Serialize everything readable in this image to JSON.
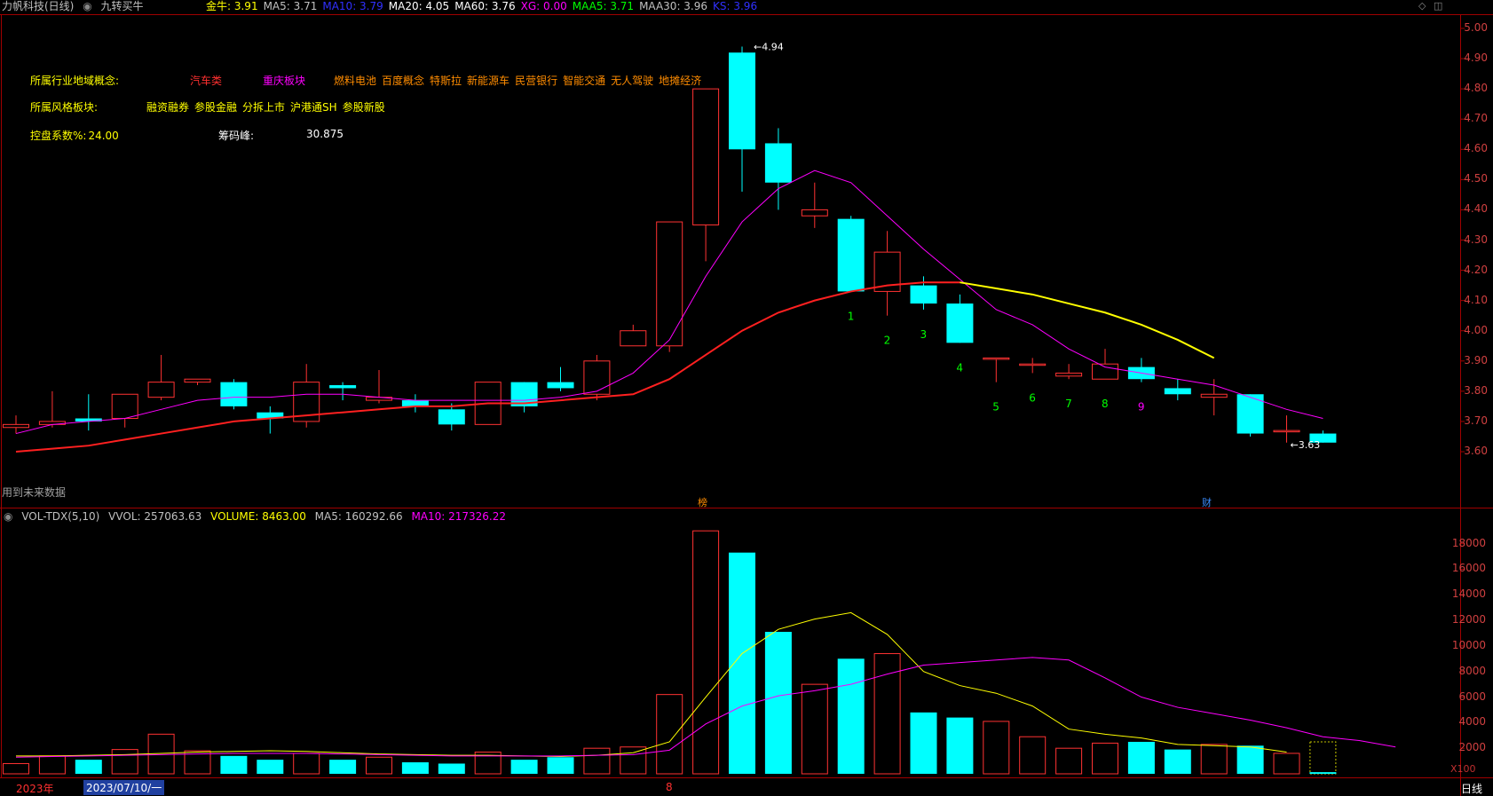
{
  "header": {
    "stock_title": "力帆科技(日线)",
    "strategy_label": "九转买牛",
    "indicators": [
      {
        "label": "金牛: 3.91",
        "color": "#ffff00"
      },
      {
        "label": "MA5: 3.71",
        "color": "#c0c0c0"
      },
      {
        "label": "MA10: 3.79",
        "color": "#3030ff"
      },
      {
        "label": "MA20: 4.05",
        "color": "#ffffff"
      },
      {
        "label": "MA60: 3.76",
        "color": "#ffffff"
      },
      {
        "label": "XG: 0.00",
        "color": "#ff00ff"
      },
      {
        "label": "MAA5: 3.71",
        "color": "#00ff00"
      },
      {
        "label": "MAA30: 3.96",
        "color": "#c0c0c0"
      },
      {
        "label": "KS: 3.96",
        "color": "#3030ff"
      }
    ]
  },
  "info": {
    "industry_label": "所属行业地域概念:",
    "industry_main": "汽车类",
    "region": "重庆板块",
    "concepts": [
      "燃料电池",
      "百度概念",
      "特斯拉",
      "新能源车",
      "民营银行",
      "智能交通",
      "无人驾驶",
      "地摊经济"
    ],
    "style_label": "所属风格板块:",
    "styles": [
      "融资融券",
      "参股金融",
      "分拆上市",
      "沪港通SH",
      "参股新股"
    ],
    "control_label": "控盘系数%:",
    "control_value": "24.00",
    "chip_label": "筹码峰:",
    "chip_value": "30.875"
  },
  "future_data_label": "用到未来数据",
  "markers": {
    "dragon": "榜",
    "finance": "财",
    "high": "4.94",
    "low": "3.63"
  },
  "volume_header": {
    "name": "VOL-TDX(5,10)",
    "vvol": "VVOL: 257063.63",
    "volume": "VOLUME: 8463.00",
    "ma5": "MA5: 160292.66",
    "ma10": "MA10: 217326.22"
  },
  "volume_unit": "X100",
  "bottom": {
    "year": "2023年",
    "date": "2023/07/10/一",
    "month": "8",
    "period": "日线"
  },
  "colors": {
    "up": "#ff3232",
    "down": "#00ffff",
    "ma_magenta": "#ff00ff",
    "ma_red": "#ff2020",
    "ma_yellow": "#ffff00",
    "axis": "#a00000"
  },
  "chart_data": {
    "type": "candlestick",
    "price_axis": {
      "ticks": [
        "5.00",
        "4.90",
        "4.80",
        "4.70",
        "4.60",
        "4.50",
        "4.40",
        "4.30",
        "4.20",
        "4.10",
        "4.00",
        "3.90",
        "3.80",
        "3.70",
        "3.60"
      ],
      "ylim": [
        3.545,
        5.0
      ]
    },
    "candles": [
      {
        "o": 3.68,
        "c": 3.69,
        "h": 3.72,
        "l": 3.66
      },
      {
        "o": 3.69,
        "c": 3.7,
        "h": 3.8,
        "l": 3.68
      },
      {
        "o": 3.71,
        "c": 3.7,
        "h": 3.79,
        "l": 3.67
      },
      {
        "o": 3.71,
        "c": 3.79,
        "h": 3.79,
        "l": 3.68
      },
      {
        "o": 3.78,
        "c": 3.83,
        "h": 3.92,
        "l": 3.77
      },
      {
        "o": 3.83,
        "c": 3.84,
        "h": 3.84,
        "l": 3.82
      },
      {
        "o": 3.83,
        "c": 3.75,
        "h": 3.84,
        "l": 3.74
      },
      {
        "o": 3.73,
        "c": 3.71,
        "h": 3.75,
        "l": 3.66
      },
      {
        "o": 3.7,
        "c": 3.83,
        "h": 3.89,
        "l": 3.68
      },
      {
        "o": 3.82,
        "c": 3.81,
        "h": 3.83,
        "l": 3.77
      },
      {
        "o": 3.77,
        "c": 3.78,
        "h": 3.87,
        "l": 3.76
      },
      {
        "o": 3.77,
        "c": 3.75,
        "h": 3.79,
        "l": 3.73
      },
      {
        "o": 3.74,
        "c": 3.69,
        "h": 3.76,
        "l": 3.67
      },
      {
        "o": 3.69,
        "c": 3.83,
        "h": 3.83,
        "l": 3.69
      },
      {
        "o": 3.83,
        "c": 3.75,
        "h": 3.83,
        "l": 3.73
      },
      {
        "o": 3.83,
        "c": 3.81,
        "h": 3.88,
        "l": 3.8
      },
      {
        "o": 3.79,
        "c": 3.9,
        "h": 3.92,
        "l": 3.77
      },
      {
        "o": 3.95,
        "c": 4.0,
        "h": 4.02,
        "l": 3.95
      },
      {
        "o": 3.95,
        "c": 4.36,
        "h": 4.36,
        "l": 3.93
      },
      {
        "o": 4.35,
        "c": 4.8,
        "h": 4.8,
        "l": 4.23
      },
      {
        "o": 4.92,
        "c": 4.6,
        "h": 4.94,
        "l": 4.46
      },
      {
        "o": 4.62,
        "c": 4.49,
        "h": 4.67,
        "l": 4.4
      },
      {
        "o": 4.38,
        "c": 4.4,
        "h": 4.49,
        "l": 4.34
      },
      {
        "o": 4.37,
        "c": 4.13,
        "h": 4.38,
        "l": 4.13
      },
      {
        "o": 4.13,
        "c": 4.26,
        "h": 4.33,
        "l": 4.05
      },
      {
        "o": 4.15,
        "c": 4.09,
        "h": 4.18,
        "l": 4.07
      },
      {
        "o": 4.09,
        "c": 3.96,
        "h": 4.12,
        "l": 3.96
      },
      {
        "o": 3.91,
        "c": 3.91,
        "h": 3.91,
        "l": 3.83
      },
      {
        "o": 3.89,
        "c": 3.89,
        "h": 3.91,
        "l": 3.86
      },
      {
        "o": 3.85,
        "c": 3.86,
        "h": 3.89,
        "l": 3.84
      },
      {
        "o": 3.84,
        "c": 3.89,
        "h": 3.94,
        "l": 3.84
      },
      {
        "o": 3.88,
        "c": 3.84,
        "h": 3.91,
        "l": 3.83
      },
      {
        "o": 3.81,
        "c": 3.79,
        "h": 3.84,
        "l": 3.77
      },
      {
        "o": 3.78,
        "c": 3.79,
        "h": 3.84,
        "l": 3.72
      },
      {
        "o": 3.79,
        "c": 3.66,
        "h": 3.79,
        "l": 3.65
      },
      {
        "o": 3.67,
        "c": 3.67,
        "h": 3.72,
        "l": 3.63
      },
      {
        "o": 3.66,
        "c": 3.63,
        "h": 3.67,
        "l": 3.63
      }
    ],
    "ma_short": [
      3.66,
      3.69,
      3.7,
      3.71,
      3.74,
      3.77,
      3.78,
      3.78,
      3.79,
      3.79,
      3.78,
      3.77,
      3.77,
      3.77,
      3.77,
      3.78,
      3.8,
      3.86,
      3.97,
      4.18,
      4.36,
      4.47,
      4.53,
      4.49,
      4.38,
      4.27,
      4.17,
      4.07,
      4.02,
      3.94,
      3.88,
      3.86,
      3.84,
      3.82,
      3.78,
      3.74,
      3.71
    ],
    "ma_long": [
      3.6,
      3.61,
      3.62,
      3.64,
      3.66,
      3.68,
      3.7,
      3.71,
      3.72,
      3.73,
      3.74,
      3.75,
      3.75,
      3.76,
      3.76,
      3.77,
      3.78,
      3.79,
      3.84,
      3.92,
      4.0,
      4.06,
      4.1,
      4.13,
      4.15,
      4.16,
      4.16
    ],
    "ma_yellow": [
      4.16,
      4.14,
      4.12,
      4.09,
      4.06,
      4.02,
      3.97,
      3.91
    ],
    "ma_yellow_start": 26,
    "nine_count": [
      "1",
      "2",
      "3",
      "4",
      "5",
      "6",
      "7",
      "8",
      "9"
    ],
    "nine_start": 23,
    "volume": {
      "ticks": [
        "18000",
        "16000",
        "14000",
        "12000",
        "10000",
        "8000",
        "6000",
        "4000",
        "2000"
      ],
      "ylim": [
        0,
        19500
      ],
      "bars": [
        800,
        1400,
        1100,
        1900,
        3100,
        1800,
        1400,
        1100,
        1600,
        1100,
        1300,
        900,
        800,
        1700,
        1100,
        1300,
        2000,
        2100,
        6200,
        19000,
        17300,
        11100,
        7000,
        9000,
        9400,
        4800,
        4400,
        4100,
        2900,
        2000,
        2400,
        2500,
        1900,
        2300,
        2200,
        1600,
        130
      ],
      "ma_yellow": [
        1400,
        1400,
        1450,
        1500,
        1600,
        1700,
        1750,
        1800,
        1750,
        1650,
        1550,
        1500,
        1450,
        1450,
        1400,
        1350,
        1450,
        1650,
        2500,
        6000,
        9400,
        11300,
        12100,
        12600,
        10900,
        8000,
        6900,
        6300,
        5300,
        3500,
        3100,
        2800,
        2300,
        2200,
        2100,
        1700
      ],
      "ma_magenta": [
        1300,
        1350,
        1400,
        1450,
        1500,
        1550,
        1600,
        1600,
        1600,
        1550,
        1500,
        1450,
        1400,
        1400,
        1400,
        1400,
        1450,
        1500,
        1850,
        3900,
        5300,
        6100,
        6500,
        7000,
        7800,
        8500,
        8700,
        8900,
        9100,
        8900,
        7500,
        6000,
        5200,
        4700,
        4200,
        3600,
        2900,
        2600,
        2100
      ]
    }
  }
}
